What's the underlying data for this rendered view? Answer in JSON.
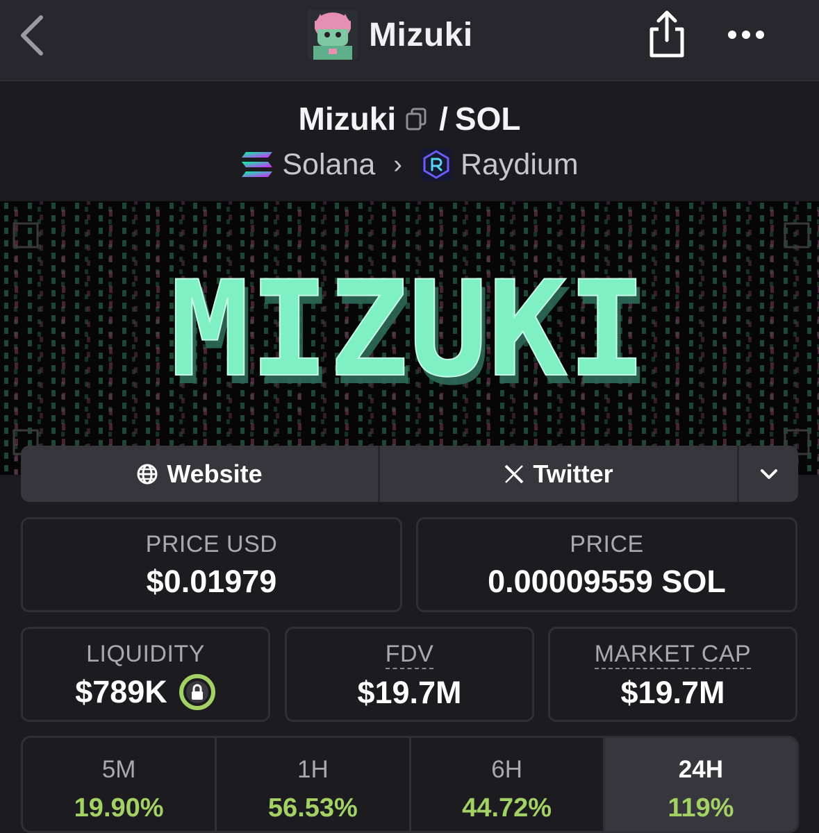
{
  "nav": {
    "title": "Mizuki",
    "back_icon": "chevron-left-icon",
    "share_icon": "share-icon",
    "more_icon": "more-icon"
  },
  "pair": {
    "base": "Mizuki",
    "separator": "/",
    "quote": "SOL",
    "chain": "Solana",
    "dex": "Raydium"
  },
  "banner": {
    "logo_text": "MIZUKI",
    "accent": "#7ff0c4"
  },
  "links": {
    "website_label": "Website",
    "twitter_label": "Twitter"
  },
  "stats": {
    "price_usd_label": "PRICE USD",
    "price_usd": "$0.01979",
    "price_label": "PRICE",
    "price_sol": "0.00009559 SOL",
    "liquidity_label": "LIQUIDITY",
    "liquidity": "$789K",
    "fdv_label": "FDV",
    "fdv": "$19.7M",
    "mcap_label": "MARKET CAP",
    "mcap": "$19.7M"
  },
  "changes": [
    {
      "label": "5M",
      "value": "19.90%"
    },
    {
      "label": "1H",
      "value": "56.53%"
    },
    {
      "label": "6H",
      "value": "44.72%"
    },
    {
      "label": "24H",
      "value": "119%"
    }
  ],
  "colors": {
    "positive": "#a3d165",
    "lock_ring": "#a3d165",
    "card_border": "#2f2f36",
    "background": "#1b1b20"
  }
}
